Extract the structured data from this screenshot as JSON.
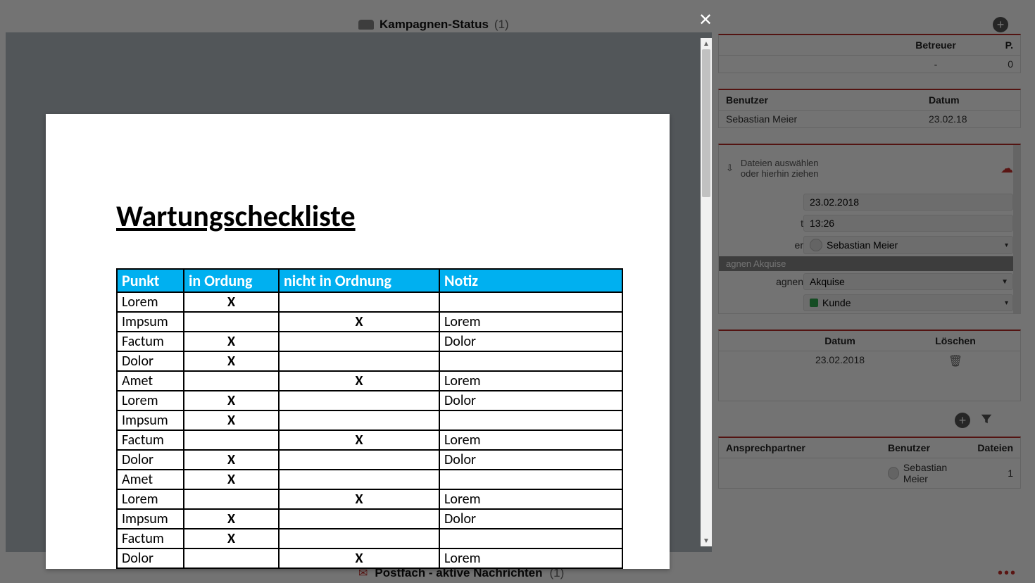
{
  "header": {
    "section_title": "Kampagnen-Status",
    "section_count": "(1)"
  },
  "right": {
    "row1": {
      "col2_header": "Betreuer",
      "col3_header": "P.",
      "col2_value": "-",
      "col3_value": "0"
    },
    "row2": {
      "col1_header": "Benutzer",
      "col2_header": "Datum",
      "col1_value": "Sebastian Meier",
      "col2_value": "23.02.18"
    },
    "upload": {
      "line1": "Dateien auswählen",
      "line2": "oder hierhin ziehen"
    },
    "form": {
      "date_value": "23.02.2018",
      "time_value": "13:26",
      "user_label_tail": "er",
      "user_value": "Sebastian Meier",
      "group_label": "agnen Akquise",
      "kampagnen_label": "agnen",
      "kampagnen_value": "Akquise",
      "status_value": "Kunde"
    },
    "row3": {
      "col1_header": "Datum",
      "col2_header": "Löschen",
      "col1_value": "23.02.2018"
    },
    "row4": {
      "col1_header": "Ansprechpartner",
      "col2_header": "Benutzer",
      "col3_header": "Dateien",
      "col2_value": "Sebastian Meier",
      "col3_value": "1"
    }
  },
  "footer": {
    "title": "Postfach - aktive Nachrichten",
    "count": "(1)"
  },
  "document": {
    "title": "Wartungscheckliste",
    "columns": [
      "Punkt",
      "in Ordung",
      "nicht in Ordnung",
      "Notiz"
    ],
    "rows": [
      {
        "punkt": "Lorem",
        "ok": "X",
        "nok": "",
        "notiz": ""
      },
      {
        "punkt": "Impsum",
        "ok": "",
        "nok": "X",
        "notiz": "Lorem"
      },
      {
        "punkt": "Factum",
        "ok": "X",
        "nok": "",
        "notiz": "Dolor"
      },
      {
        "punkt": "Dolor",
        "ok": "X",
        "nok": "",
        "notiz": ""
      },
      {
        "punkt": "Amet",
        "ok": "",
        "nok": "X",
        "notiz": "Lorem"
      },
      {
        "punkt": "Lorem",
        "ok": "X",
        "nok": "",
        "notiz": "Dolor"
      },
      {
        "punkt": "Impsum",
        "ok": "X",
        "nok": "",
        "notiz": ""
      },
      {
        "punkt": "Factum",
        "ok": "",
        "nok": "X",
        "notiz": "Lorem"
      },
      {
        "punkt": "Dolor",
        "ok": "X",
        "nok": "",
        "notiz": "Dolor"
      },
      {
        "punkt": "Amet",
        "ok": "X",
        "nok": "",
        "notiz": ""
      },
      {
        "punkt": "Lorem",
        "ok": "",
        "nok": "X",
        "notiz": "Lorem"
      },
      {
        "punkt": "Impsum",
        "ok": "X",
        "nok": "",
        "notiz": "Dolor"
      },
      {
        "punkt": "Factum",
        "ok": "X",
        "nok": "",
        "notiz": ""
      },
      {
        "punkt": "Dolor",
        "ok": "",
        "nok": "X",
        "notiz": "Lorem"
      }
    ]
  }
}
